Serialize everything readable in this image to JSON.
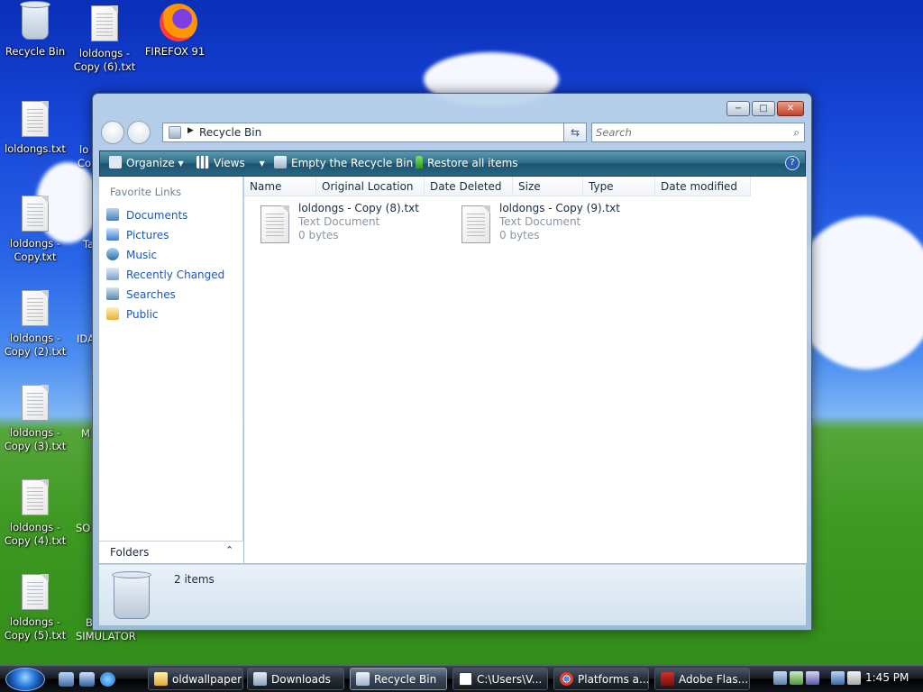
{
  "desktop": {
    "icons": [
      {
        "label": "Recycle Bin"
      },
      {
        "label": "loldongs - Copy (6).txt"
      },
      {
        "label": "FIREFOX 91"
      },
      {
        "label": "loldongs.txt"
      },
      {
        "label": "loldongs - Copy.txt"
      },
      {
        "label": "loldongs - Copy (2).txt"
      },
      {
        "label": "loldongs - Copy (3).txt"
      },
      {
        "label": "loldongs - Copy (4).txt"
      },
      {
        "label": "loldongs - Copy (5).txt"
      }
    ],
    "partial_labels": [
      "lo",
      "Co",
      "Ta",
      "IDA",
      "M",
      "SO",
      "B",
      "SIMULATOR"
    ]
  },
  "window": {
    "address": "Recycle Bin",
    "search_placeholder": "Search",
    "toolbar": {
      "organize": "Organize",
      "views": "Views",
      "empty": "Empty the Recycle Bin",
      "restore": "Restore all items",
      "help": "?"
    },
    "favorites": {
      "title": "Favorite Links",
      "items": [
        "Documents",
        "Pictures",
        "Music",
        "Recently Changed",
        "Searches",
        "Public"
      ]
    },
    "folders_label": "Folders",
    "columns": [
      "Name",
      "Original Location",
      "Date Deleted",
      "Size",
      "Type",
      "Date modified"
    ],
    "files": [
      {
        "name": "loldongs - Copy (8).txt",
        "type": "Text Document",
        "size": "0 bytes"
      },
      {
        "name": "loldongs - Copy (9).txt",
        "type": "Text Document",
        "size": "0 bytes"
      }
    ],
    "status": "2 items"
  },
  "taskbar": {
    "buttons": [
      "oldwallpaper",
      "Downloads",
      "Recycle Bin",
      "C:\\Users\\V...",
      "Platforms a...",
      "Adobe Flas..."
    ],
    "active": "Recycle Bin",
    "clock": "1:45 PM"
  },
  "colors": {
    "toolbar": "#2d6c86",
    "link": "#1d58b4",
    "accent": "#2a7be0"
  }
}
